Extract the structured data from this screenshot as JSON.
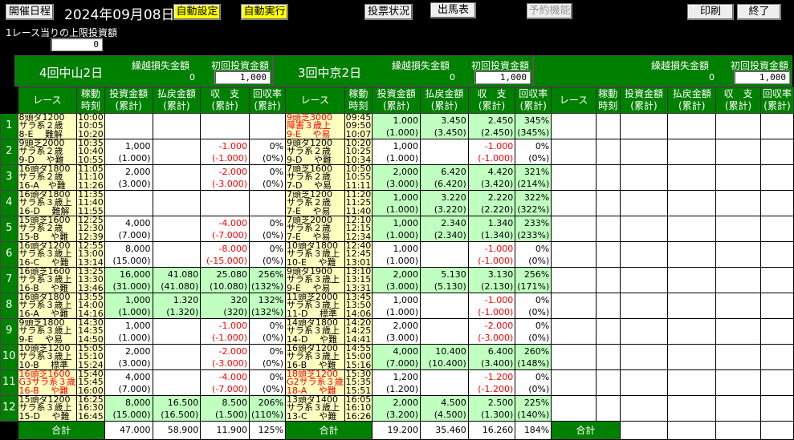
{
  "toolbar": {
    "schedule": "開催日程",
    "date": "2024年09月08日",
    "auto_setting": "自動設定",
    "auto_run": "自動実行",
    "bet_status": "投票状況",
    "entries": "出馬表",
    "reservation": "予約機能",
    "print": "印刷",
    "exit": "終了"
  },
  "limit": {
    "label": "1レース当りの上限投資額",
    "value": "0"
  },
  "headers": {
    "race": "レース",
    "time": [
      "稼動",
      "時刻"
    ],
    "invest": [
      "投資金額",
      "(累計)"
    ],
    "payout": [
      "払戻金額",
      "(累計)"
    ],
    "balance": [
      "収　支",
      "(累計)"
    ],
    "rate": [
      "回収率",
      "(累計)"
    ],
    "total": "合計",
    "carry_label": "繰越損失金額",
    "initial_label": "初回投資金額"
  },
  "colors": {
    "green": "#008000",
    "win": "#c0ffc0",
    "info": "#ffffc0",
    "negative": "#ff0000"
  },
  "race_numbers": [
    "1",
    "2",
    "3",
    "4",
    "5",
    "6",
    "7",
    "8",
    "9",
    "10",
    "11",
    "12"
  ],
  "venues": [
    {
      "name": "4回中山2日",
      "carry": "0",
      "initial": "1,000",
      "races": [
        {
          "info": [
            "8頭ダ1200",
            "サラ系２歳",
            "8-E　 難解"
          ],
          "times": [
            "10:00",
            "10:05",
            "10:20"
          ]
        },
        {
          "info": [
            "9頭芝2000",
            "サラ系２歳",
            "9-D　 や難"
          ],
          "times": [
            "10:35",
            "10:40",
            "10:55"
          ],
          "inv": [
            "1,000",
            "(1.000)"
          ],
          "bal": [
            "-1.000",
            "(-1.000)"
          ],
          "rate": [
            "0%",
            "(0%)"
          ]
        },
        {
          "info": [
            "16頭ダ1800",
            "サラ系２歳",
            "16-A　や難"
          ],
          "times": [
            "11:05",
            "11:10",
            "11:26"
          ],
          "inv": [
            "2,000",
            "(3.000)"
          ],
          "bal": [
            "-2.000",
            "(-3.000)"
          ],
          "rate": [
            "0%",
            "(0%)"
          ]
        },
        {
          "info": [
            "16頭ダ1800",
            "サラ系３歳上",
            "16-D　 難解"
          ],
          "times": [
            "11:35",
            "11:40",
            "11:55"
          ]
        },
        {
          "info": [
            "15頭芝1600",
            "サラ系２歳",
            "15-B　 や難"
          ],
          "times": [
            "12:25",
            "12:30",
            "12:39"
          ],
          "inv": [
            "4,000",
            "(7.000)"
          ],
          "bal": [
            "-4.000",
            "(-7.000)"
          ],
          "rate": [
            "0%",
            "(0%)"
          ]
        },
        {
          "info": [
            "16頭ダ1200",
            "サラ系３歳上",
            "16-C　 や難"
          ],
          "times": [
            "12:55",
            "13:00",
            "13:14"
          ],
          "inv": [
            "8,000",
            "(15.000)"
          ],
          "bal": [
            "-8.000",
            "(-15.000)"
          ],
          "rate": [
            "0%",
            "(0%)"
          ]
        },
        {
          "info": [
            "16頭芝1600",
            "サラ系３歳上",
            "16-B　 や難"
          ],
          "times": [
            "13:25",
            "13:30",
            "13:46"
          ],
          "win": true,
          "inv": [
            "16,000",
            "(31.000)"
          ],
          "pay": [
            "41.080",
            "(41.080)"
          ],
          "bal": [
            "25.080",
            "(10.080)"
          ],
          "rate": [
            "256%",
            "(132%)"
          ]
        },
        {
          "info": [
            "16頭ダ1800",
            "サラ系３歳上",
            "16-A　 や難"
          ],
          "times": [
            "13:55",
            "14:00",
            "14:16"
          ],
          "win": true,
          "inv": [
            "1,000",
            "(1.000)"
          ],
          "pay": [
            "1.320",
            "(1.320)"
          ],
          "bal": [
            "320",
            "(320)"
          ],
          "rate": [
            "132%",
            "(132%)"
          ]
        },
        {
          "info": [
            "9頭芝1800",
            "サラ系３歳上",
            "9-E　  や易"
          ],
          "times": [
            "14:30",
            "14:35",
            "14:50"
          ],
          "inv": [
            "1,000",
            "(1.000)"
          ],
          "bal": [
            "-1.000",
            "(-1.000)"
          ],
          "rate": [
            "0%",
            "(0%)"
          ]
        },
        {
          "info": [
            "10頭芝1200",
            "サラ系３歳上",
            "10-B　 標準"
          ],
          "times": [
            "15:05",
            "15:10",
            "15:24"
          ],
          "inv": [
            "2,000",
            "(3.000)"
          ],
          "bal": [
            "-2.000",
            "(-3.000)"
          ],
          "rate": [
            "0%",
            "(0%)"
          ]
        },
        {
          "info": [
            "16頭芝1600",
            "G3サラ系３歳",
            "16-B　 や難"
          ],
          "times": [
            "15:40",
            "15:45",
            "16:00"
          ],
          "red": true,
          "inv": [
            "4,000",
            "(7.000)"
          ],
          "bal": [
            "-4.000",
            "(-7.000)"
          ],
          "rate": [
            "0%",
            "(0%)"
          ]
        },
        {
          "info": [
            "15頭ダ1200",
            "サラ系３歳上",
            "15-D　 や難"
          ],
          "times": [
            "16:25",
            "16:30",
            "16:45"
          ],
          "win": true,
          "inv": [
            "8,000",
            "(15.000)"
          ],
          "pay": [
            "16.500",
            "(16.500)"
          ],
          "bal": [
            "8.500",
            "(1.500)"
          ],
          "rate": [
            "206%",
            "(110%)"
          ]
        }
      ],
      "totals": {
        "inv": "47.000",
        "pay": "58.900",
        "bal": "11.900",
        "rate": "125%"
      }
    },
    {
      "name": "3回中京2日",
      "carry": "0",
      "initial": "1,000",
      "races": [
        {
          "info": [
            "9頭芝3000",
            "障害３歳上",
            "9-E　  や易"
          ],
          "times": [
            "09:45",
            "09:50",
            "10:07"
          ],
          "red": true,
          "win": true,
          "inv": [
            "1.000",
            "(1.000)"
          ],
          "pay": [
            "3.450",
            "(3.450)"
          ],
          "bal": [
            "2.450",
            "(2.450)"
          ],
          "rate": [
            "345%",
            "(345%)"
          ]
        },
        {
          "info": [
            "9頭ダ1200",
            "サラ系２歳",
            "9-D　  や難"
          ],
          "times": [
            "10:20",
            "10:25",
            "10:34"
          ],
          "inv": [
            "1,000",
            "(1.000)"
          ],
          "bal": [
            "-1.000",
            "(-1.000)"
          ],
          "rate": [
            "0%",
            "(0%)"
          ]
        },
        {
          "info": [
            "7頭芝1600",
            "サラ系２歳",
            "7-D　  や易"
          ],
          "times": [
            "10:50",
            "10:55",
            "11:11"
          ],
          "win": true,
          "inv": [
            "2,000",
            "(3.000)"
          ],
          "pay": [
            "6.420",
            "(6.420)"
          ],
          "bal": [
            "4.420",
            "(3.420)"
          ],
          "rate": [
            "321%",
            "(214%)"
          ]
        },
        {
          "info": [
            "7頭芝1200",
            "サラ系２歳",
            "7-E　  や易"
          ],
          "times": [
            "11:20",
            "11:25",
            "11:40"
          ],
          "win": true,
          "inv": [
            "1,000",
            "(1.000)"
          ],
          "pay": [
            "3.220",
            "(3.220)"
          ],
          "bal": [
            "2.220",
            "(2.220)"
          ],
          "rate": [
            "322%",
            "(322%)"
          ]
        },
        {
          "info": [
            "7頭芝2000",
            "サラ系２歳",
            "7-E　  や易"
          ],
          "times": [
            "12:10",
            "12:15",
            "12:34"
          ],
          "win": true,
          "inv": [
            "1,000",
            "(1.000)"
          ],
          "pay": [
            "2.340",
            "(2.340)"
          ],
          "bal": [
            "1.340",
            "(1.340)"
          ],
          "rate": [
            "233%",
            "(233%)"
          ]
        },
        {
          "info": [
            "10頭ダ1800",
            "サラ系３歳上",
            "10-E　 や難"
          ],
          "times": [
            "12:40",
            "12:45",
            "13:01"
          ],
          "inv": [
            "1,000",
            "(1.000)"
          ],
          "bal": [
            "-1.000",
            "(-1.000)"
          ],
          "rate": [
            "0%",
            "(0%)"
          ]
        },
        {
          "info": [
            "9頭ダ1900",
            "サラ系３歳上",
            "9-E　  や易"
          ],
          "times": [
            "13:10",
            "13:15",
            "13:31"
          ],
          "win": true,
          "inv": [
            "2,000",
            "(3.000)"
          ],
          "pay": [
            "5.130",
            "(5.130)"
          ],
          "bal": [
            "3.130",
            "(2.130)"
          ],
          "rate": [
            "256%",
            "(171%)"
          ]
        },
        {
          "info": [
            "11頭芝2000",
            "サラ系３歳上",
            "11-D　 標準"
          ],
          "times": [
            "13:45",
            "13:50",
            "14:06"
          ],
          "inv": [
            "1,000",
            "(1.000)"
          ],
          "bal": [
            "-1.000",
            "(-1.000)"
          ],
          "rate": [
            "0%",
            "(0%)"
          ]
        },
        {
          "info": [
            "14頭ダ1800",
            "サラ系３歳上",
            "14-D　 や難"
          ],
          "times": [
            "14:20",
            "14:25",
            "14:41"
          ],
          "inv": [
            "2,000",
            "(3.000)"
          ],
          "bal": [
            "-2.000",
            "(-3.000)"
          ],
          "rate": [
            "0%",
            "(0%)"
          ]
        },
        {
          "info": [
            "16頭ダ1200",
            "サラ系３歳上",
            "16-B　 や難"
          ],
          "times": [
            "14:55",
            "15:00",
            "15:16"
          ],
          "win": true,
          "inv": [
            "4,000",
            "(7.000)"
          ],
          "pay": [
            "10.400",
            "(10.400)"
          ],
          "bal": [
            "6.400",
            "(3.400)"
          ],
          "rate": [
            "260%",
            "(148%)"
          ]
        },
        {
          "info": [
            "18頭芝1200",
            "G2サラ系３歳",
            "18-A　 や難"
          ],
          "times": [
            "15:30",
            "15:35",
            "15:51"
          ],
          "red": true,
          "inv": [
            "1,200",
            "(1.200)"
          ],
          "bal": [
            "-1.200",
            "(-1.200)"
          ],
          "rate": [
            "0%",
            "(0%)"
          ]
        },
        {
          "info": [
            "13頭ダ1400",
            "サラ系３歳上",
            "13-C　 や難"
          ],
          "times": [
            "16:05",
            "16:10",
            "16:26"
          ],
          "win": true,
          "inv": [
            "2,000",
            "(3.200)"
          ],
          "pay": [
            "4.500",
            "(4.500)"
          ],
          "bal": [
            "2.500",
            "(1.300)"
          ],
          "rate": [
            "225%",
            "(140%)"
          ]
        }
      ],
      "totals": {
        "inv": "19.200",
        "pay": "35.460",
        "bal": "16.260",
        "rate": "184%"
      }
    },
    {
      "name": "",
      "carry": "0",
      "initial": "1,000",
      "races": [
        {},
        {},
        {},
        {},
        {},
        {},
        {},
        {},
        {},
        {},
        {},
        {}
      ],
      "totals": {}
    }
  ]
}
